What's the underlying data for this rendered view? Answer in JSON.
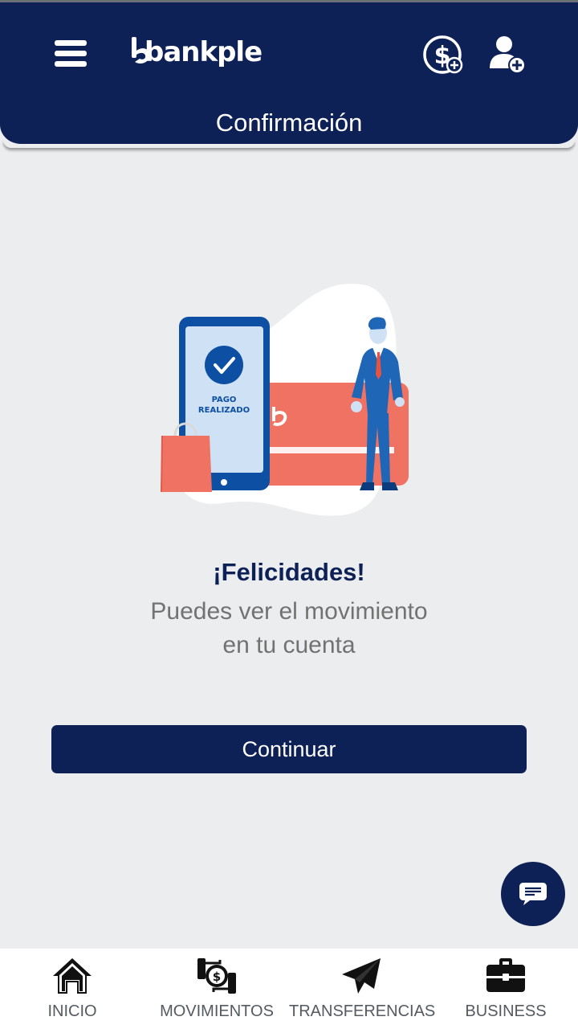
{
  "app": {
    "name": "bankple"
  },
  "header": {
    "title": "Confirmación",
    "menu_icon": "hamburger-menu-icon",
    "money_icon": "dollar-plus-icon",
    "user_icon": "user-plus-icon"
  },
  "illustration": {
    "phone_text_line1": "PAGO",
    "phone_text_line2": "REALIZADO"
  },
  "main": {
    "congrats_title": "¡Felicidades!",
    "message_line1": "Puedes ver el movimiento",
    "message_line2": "en tu cuenta",
    "continue_label": "Continuar"
  },
  "chat": {
    "icon": "chat-bubble-icon"
  },
  "bottom_nav": {
    "items": [
      {
        "label": "INICIO",
        "icon": "home-icon"
      },
      {
        "label": "MOVIMIENTOS",
        "icon": "money-exchange-icon"
      },
      {
        "label": "TRANSFERENCIAS",
        "icon": "paper-plane-icon"
      },
      {
        "label": "BUSINESS",
        "icon": "briefcase-icon"
      }
    ]
  },
  "colors": {
    "primary": "#0e2157",
    "background": "#ecedef",
    "accent_card": "#f07263",
    "phone_blue": "#0d4fa3",
    "suit_blue": "#1f66b7"
  }
}
